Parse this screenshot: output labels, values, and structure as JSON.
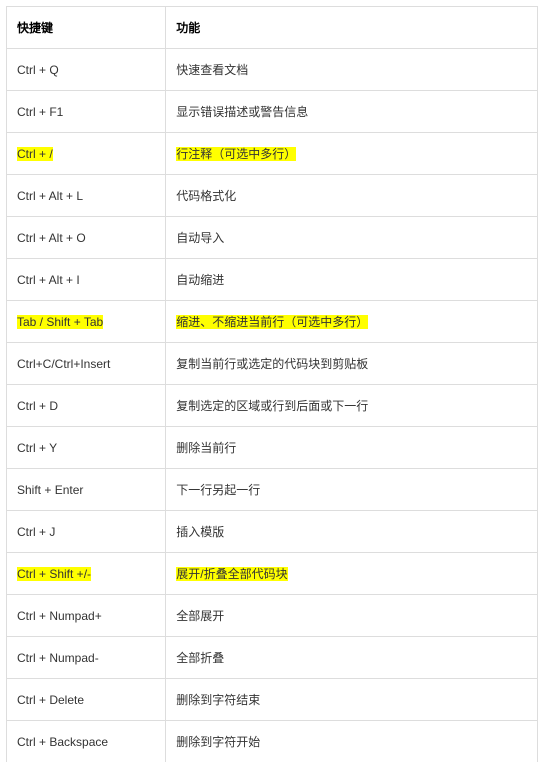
{
  "headers": {
    "shortcut": "快捷键",
    "description": "功能"
  },
  "rows": [
    {
      "shortcut": "Ctrl + Q",
      "description": "快速查看文档",
      "highlight": false
    },
    {
      "shortcut": "Ctrl + F1",
      "description": "显示错误描述或警告信息",
      "highlight": false
    },
    {
      "shortcut": "Ctrl + /",
      "description": "行注释（可选中多行）",
      "highlight": true
    },
    {
      "shortcut": "Ctrl + Alt + L",
      "description": "代码格式化",
      "highlight": false
    },
    {
      "shortcut": "Ctrl + Alt + O",
      "description": "自动导入",
      "highlight": false
    },
    {
      "shortcut": "Ctrl + Alt + I",
      "description": "自动缩进",
      "highlight": false
    },
    {
      "shortcut": "Tab / Shift + Tab",
      "description": "缩进、不缩进当前行（可选中多行）",
      "highlight": true
    },
    {
      "shortcut": "Ctrl+C/Ctrl+Insert",
      "description": "复制当前行或选定的代码块到剪贴板",
      "highlight": false
    },
    {
      "shortcut": "Ctrl + D",
      "description": "复制选定的区域或行到后面或下一行",
      "highlight": false
    },
    {
      "shortcut": "Ctrl + Y",
      "description": "删除当前行",
      "highlight": false
    },
    {
      "shortcut": "Shift + Enter",
      "description": "下一行另起一行",
      "highlight": false
    },
    {
      "shortcut": "Ctrl + J",
      "description": "插入模版",
      "highlight": false
    },
    {
      "shortcut": "Ctrl + Shift +/-",
      "description": "展开/折叠全部代码块",
      "highlight": true
    },
    {
      "shortcut": "Ctrl + Numpad+",
      "description": "全部展开",
      "highlight": false
    },
    {
      "shortcut": "Ctrl + Numpad-",
      "description": "全部折叠",
      "highlight": false
    },
    {
      "shortcut": "Ctrl + Delete",
      "description": "删除到字符结束",
      "highlight": false
    },
    {
      "shortcut": "Ctrl + Backspace",
      "description": "删除到字符开始",
      "highlight": false
    }
  ]
}
